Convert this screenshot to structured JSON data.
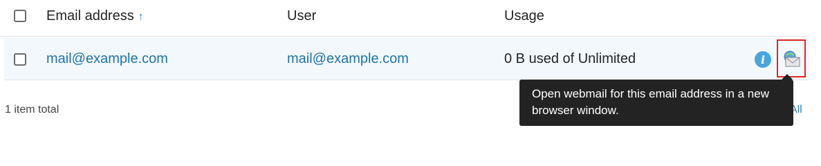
{
  "table": {
    "columns": {
      "email": "Email address",
      "email_sort_indicator": "↑",
      "user": "User",
      "usage": "Usage"
    },
    "rows": [
      {
        "email": "mail@example.com",
        "user": "mail@example.com",
        "usage": "0 B used of Unlimited"
      }
    ],
    "info_icon_glyph": "i"
  },
  "footer": {
    "total": "1 item total",
    "all_link": "All"
  },
  "tooltip": {
    "text": "Open webmail for this email address in a new browser window."
  },
  "icons": [
    "info-icon",
    "webmail-envelope-icon"
  ],
  "colors": {
    "link": "#1f74a8",
    "highlight_border": "#e02525",
    "tooltip_bg": "#232323",
    "row_bg": "#f3f8fc"
  }
}
